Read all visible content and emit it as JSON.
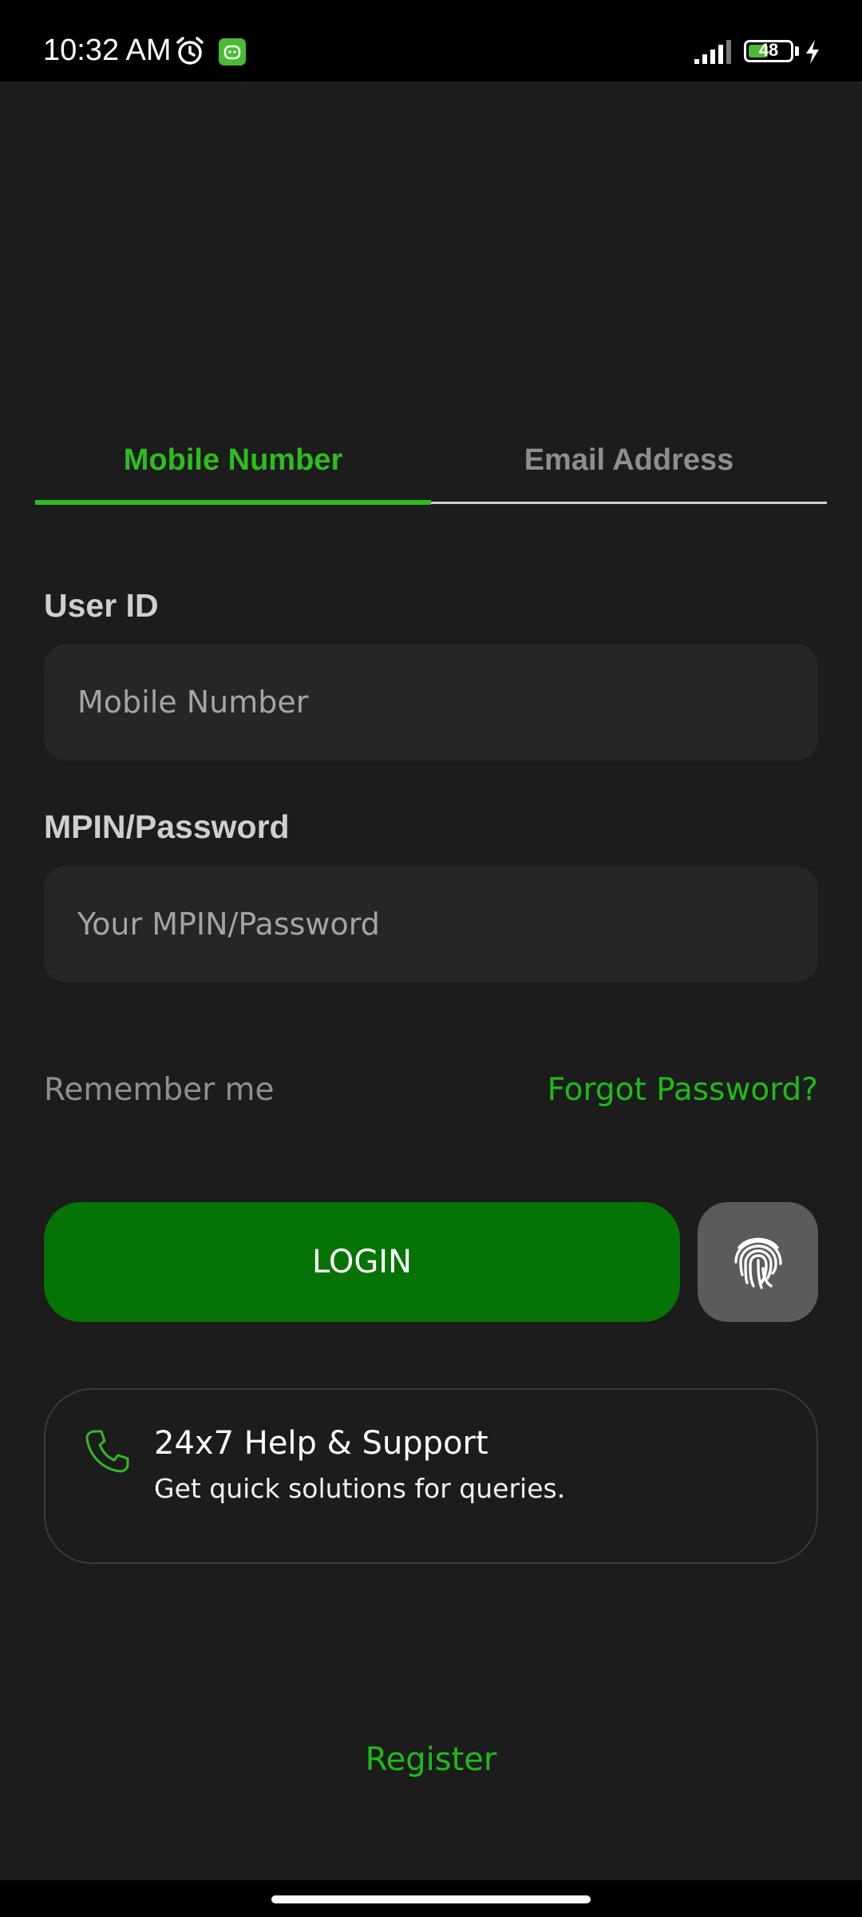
{
  "status_bar": {
    "time": "10:32 AM",
    "battery": "48",
    "battery_level": 0.48,
    "icons": [
      "alarm-icon",
      "app-notification-icon",
      "signal-icon",
      "battery-icon",
      "charging-icon"
    ]
  },
  "tabs": [
    {
      "label": "Mobile Number",
      "active": true
    },
    {
      "label": "Email Address",
      "active": false
    }
  ],
  "form": {
    "user_id_label": "User ID",
    "user_id_placeholder": "Mobile Number",
    "user_id_value": "",
    "password_label": "MPIN/Password",
    "password_placeholder": "Your MPIN/Password",
    "password_value": "",
    "remember_me": "Remember me",
    "forgot_password": "Forgot Password?"
  },
  "actions": {
    "login": "LOGIN",
    "fingerprint_icon": "fingerprint-icon"
  },
  "help": {
    "title": "24x7 Help & Support",
    "subtitle": "Get quick solutions for queries.",
    "icon": "phone-icon"
  },
  "footer": {
    "register": "Register"
  },
  "colors": {
    "background": "#1c1c1c",
    "accent": "#2ebd1e",
    "login_button": "#057305",
    "fingerprint_button": "#5b5b5b",
    "input_background": "#262527"
  }
}
